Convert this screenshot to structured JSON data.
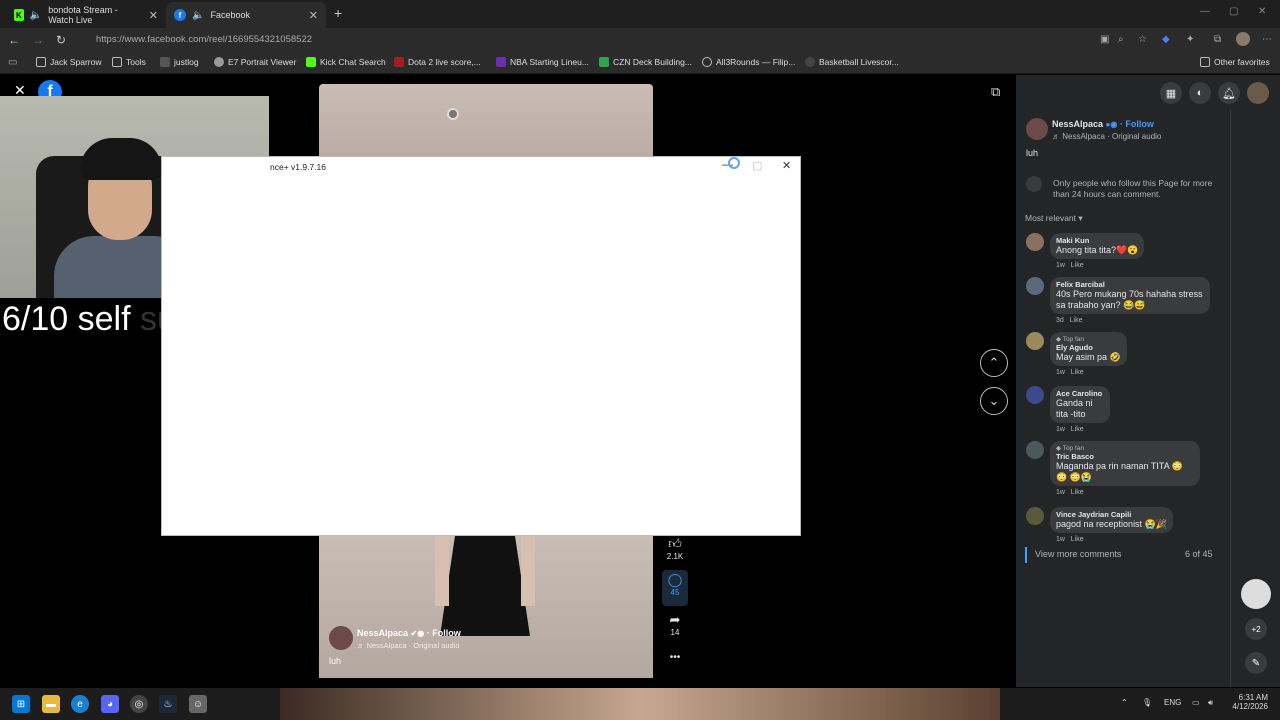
{
  "tabs": [
    {
      "label": "bondota Stream - Watch Live",
      "favicon": "K",
      "close": "✕"
    },
    {
      "label": "Facebook",
      "favicon": "f",
      "close": "✕"
    }
  ],
  "new_tab": "+",
  "url": "https://www.facebook.com/reel/1669554321058522",
  "bookmarks": [
    "Jack Sparrow",
    "Tools",
    "justlog",
    "E7 Portrait Viewer",
    "Kick Chat Search",
    "Dota 2 live score,...",
    "NBA Starting Lineu...",
    "CZN Deck Building...",
    "All3Rounds — Filip...",
    "Basketball Livescor..."
  ],
  "other_favorites": "Other favorites",
  "overlay": {
    "text": "6/10 self",
    "faded": "suc"
  },
  "dialog": {
    "title": "nce+ v1.9.7.16"
  },
  "reel": {
    "likes": "2.1K",
    "comments": "45",
    "shares": "14",
    "more": "•••",
    "author": "NessAlpaca",
    "follow": "· Follow",
    "audio": "♬ NessAlpaca · Original audio",
    "caption": "luh"
  },
  "post": {
    "author": "NessAlpaca",
    "follow": "· Follow",
    "audio": "♬ NessAlpaca · Original audio",
    "caption": "luh",
    "notice": "Only people who follow this Page for more than 24 hours can comment.",
    "sort": "Most relevant"
  },
  "comments": [
    {
      "name": "Maki Kun",
      "badge": "",
      "text": "Anong tita tita?❤️😮",
      "time": "1w",
      "action": "Like"
    },
    {
      "name": "Felix Barcibal",
      "badge": "",
      "text": "40s Pero mukang 70s hahaha stress sa trabaho yan? 😂😅",
      "time": "3d",
      "action": "Like"
    },
    {
      "name": "Ely Agudo",
      "badge": "Top fan",
      "text": "May asim pa 🤣",
      "time": "1w",
      "action": "Like"
    },
    {
      "name": "Ace Carolino",
      "badge": "",
      "text": "Ganda ni tita -tito",
      "time": "1w",
      "action": "Like"
    },
    {
      "name": "Tric Basco",
      "badge": "Top fan",
      "text": "Maganda pa rin naman TITA 😳😳 😳😭",
      "time": "1w",
      "action": "Like"
    },
    {
      "name": "Vince Jaydrian Capili",
      "badge": "",
      "text": "pagod na receptionist 😭🎉",
      "time": "1w",
      "action": "Like"
    }
  ],
  "view_more": "View more comments",
  "count": "6 of 45",
  "plus_badge": "+2",
  "taskbar": {
    "lang": "ENG",
    "time": "6:31 AM",
    "date": "4/12/2026"
  }
}
